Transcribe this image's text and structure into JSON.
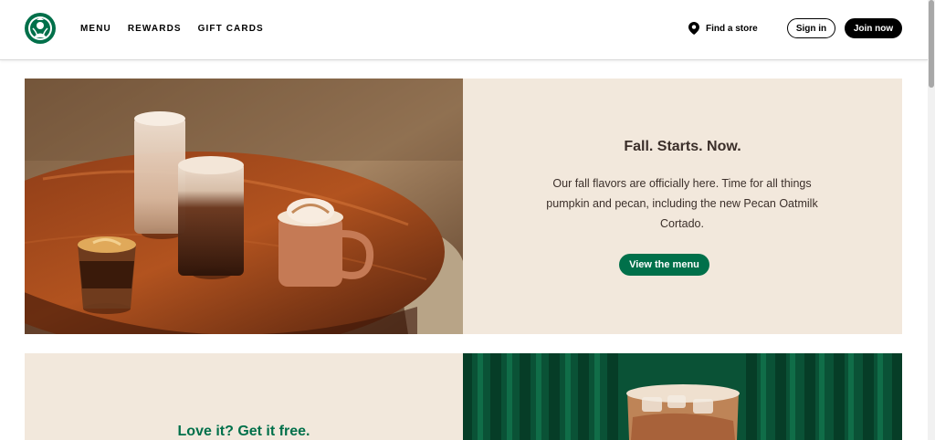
{
  "header": {
    "nav": [
      "MENU",
      "REWARDS",
      "GIFT CARDS"
    ],
    "find_store": "Find a store",
    "sign_in": "Sign in",
    "join_now": "Join now"
  },
  "hero": {
    "title": "Fall. Starts. Now.",
    "body": "Our fall flavors are officially here. Time for all things pumpkin and pecan, including the new Pecan Oatmilk Cortado.",
    "cta": "View the menu"
  },
  "promo": {
    "title": "Love it? Get it free."
  },
  "colors": {
    "brand_green": "#00704a",
    "cream": "#f2e8dc",
    "dark_brown": "#3b2f2a"
  },
  "icons": [
    "siren-logo-icon",
    "location-pin-icon"
  ]
}
